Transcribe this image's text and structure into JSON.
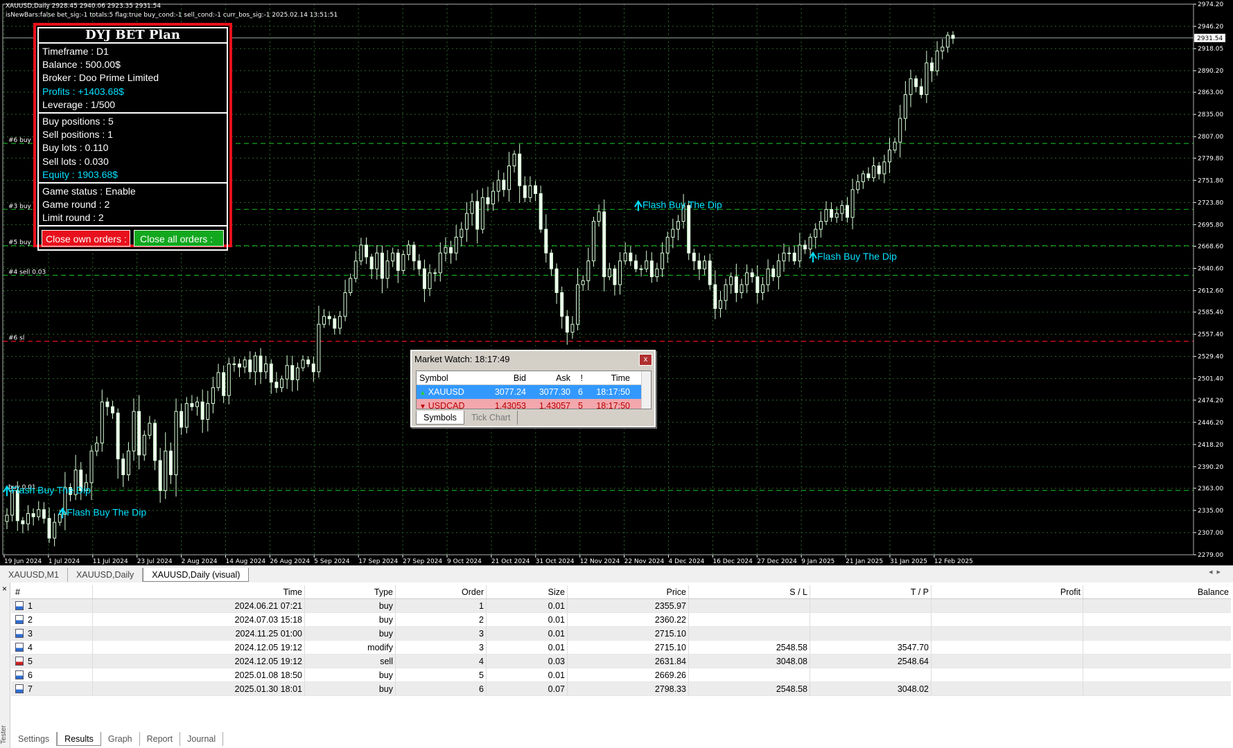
{
  "chart": {
    "symbol_info": "XAUUSD,Daily  2928.45 2940.06 2923.35 2931.54",
    "status_line": "isNewBars:false bet_sig:-1 totals:5 flag:true buy_cond:-1 sell_cond:-1 curr_bos_sig:-1 2025.02.14 13:51:51",
    "current_price": "2931.54",
    "price_labels": [
      "2974.20",
      "2946.20",
      "2918.05",
      "2890.20",
      "2863.00",
      "2835.00",
      "2807.00",
      "2779.80",
      "2751.80",
      "2723.80",
      "2695.80",
      "2668.60",
      "2640.60",
      "2612.60",
      "2585.40",
      "2557.40",
      "2529.40",
      "2501.40",
      "2474.20",
      "2446.20",
      "2418.20",
      "2390.20",
      "2363.00",
      "2335.00",
      "2307.00",
      "2279.00"
    ],
    "date_labels": [
      "19 Jun 2024",
      "1 Jul 2024",
      "11 Jul 2024",
      "23 Jul 2024",
      "2 Aug 2024",
      "14 Aug 2024",
      "26 Aug 2024",
      "5 Sep 2024",
      "17 Sep 2024",
      "27 Sep 2024",
      "9 Oct 2024",
      "21 Oct 2024",
      "31 Oct 2024",
      "12 Nov 2024",
      "22 Nov 2024",
      "4 Dec 2024",
      "16 Dec 2024",
      "27 Dec 2024",
      "9 Jan 2025",
      "21 Jan 2025",
      "31 Jan 2025",
      "12 Feb 2025"
    ],
    "level_lines": [
      {
        "label": "#6 buy",
        "price": 2798.33,
        "color": "#12a81e"
      },
      {
        "label": "#3 buy",
        "price": 2715.1,
        "color": "#12a81e"
      },
      {
        "label": "#5 buy",
        "price": 2669.26,
        "color": "#12a81e"
      },
      {
        "label": "#4 sell 0.03",
        "price": 2631.84,
        "color": "#12a81e"
      },
      {
        "label": "#6 sl",
        "price": 2548.58,
        "color": "#e8101c"
      },
      {
        "label": "buy 0.01",
        "price": 2360.22,
        "color": "#12a81e"
      }
    ],
    "annotations": [
      {
        "text": "Flash Buy The Dip",
        "date": "2024-06-19",
        "price": 2360
      },
      {
        "text": "Flash Buy The Dip",
        "date": "2024-07-03",
        "price": 2332
      },
      {
        "text": "Flash Buy The Dip",
        "date": "2024-11-25",
        "price": 2720
      },
      {
        "text": "Flash Buy The Dip",
        "date": "2025-01-08",
        "price": 2655
      }
    ]
  },
  "chart_data": {
    "type": "candlestick",
    "symbol": "XAUUSD",
    "timeframe": "Daily",
    "ylim": [
      2279,
      2974.2
    ],
    "x_range": [
      "19 Jun 2024",
      "14 Feb 2025"
    ],
    "close": [
      2329,
      2360,
      2322,
      2318,
      2331,
      2327,
      2336,
      2325,
      2300,
      2320,
      2330,
      2364,
      2355,
      2386,
      2360,
      2370,
      2410,
      2420,
      2472,
      2466,
      2458,
      2400,
      2380,
      2410,
      2460,
      2405,
      2430,
      2445,
      2398,
      2360,
      2410,
      2380,
      2460,
      2440,
      2470,
      2466,
      2472,
      2450,
      2470,
      2490,
      2509,
      2480,
      2520,
      2520,
      2516,
      2525,
      2510,
      2530,
      2510,
      2520,
      2497,
      2490,
      2501,
      2518,
      2500,
      2515,
      2525,
      2520,
      2510,
      2570,
      2580,
      2577,
      2565,
      2580,
      2610,
      2628,
      2650,
      2670,
      2655,
      2640,
      2660,
      2628,
      2650,
      2660,
      2638,
      2658,
      2670,
      2650,
      2640,
      2615,
      2635,
      2635,
      2660,
      2667,
      2660,
      2680,
      2690,
      2710,
      2725,
      2690,
      2730,
      2722,
      2738,
      2752,
      2740,
      2770,
      2785,
      2745,
      2730,
      2745,
      2735,
      2690,
      2660,
      2640,
      2610,
      2580,
      2560,
      2570,
      2620,
      2625,
      2650,
      2700,
      2712,
      2630,
      2640,
      2620,
      2650,
      2660,
      2650,
      2640,
      2640,
      2650,
      2630,
      2640,
      2660,
      2680,
      2690,
      2700,
      2720,
      2660,
      2650,
      2640,
      2650,
      2620,
      2590,
      2600,
      2620,
      2630,
      2610,
      2620,
      2635,
      2630,
      2610,
      2620,
      2640,
      2630,
      2650,
      2660,
      2660,
      2650,
      2670,
      2665,
      2680,
      2690,
      2700,
      2715,
      2705,
      2710,
      2720,
      2705,
      2740,
      2750,
      2760,
      2755,
      2770,
      2760,
      2775,
      2790,
      2800,
      2830,
      2860,
      2880,
      2870,
      2860,
      2900,
      2890,
      2915,
      2920,
      2935,
      2931
    ],
    "series": [
      {
        "name": "Flash Buy The Dip",
        "values": [
          "2024-06-19",
          "2024-07-03",
          "2024-11-25",
          "2025-01-08"
        ]
      }
    ]
  },
  "panel": {
    "title": "DYJ BET Plan",
    "timeframe": "Timeframe : D1",
    "balance": "Balance : 500.00$",
    "broker": "Broker : Doo Prime Limited",
    "profits": "Profits : +1403.68$",
    "leverage": "Leverage : 1/500",
    "buy_positions": "Buy positions : 5",
    "sell_positions": "Sell positions : 1",
    "buy_lots": "Buy lots : 0.110",
    "sell_lots": "Sell lots : 0.030",
    "equity": "Equity : 1903.68$",
    "game_status": "Game status :  Enable",
    "game_round": "Game round : 2",
    "limit_round": "Limit round : 2",
    "close_own": "Close own orders :",
    "close_all": "Close all orders :",
    "colors": {
      "border": "#e8101c",
      "cyan": "#00e0ff",
      "green_button": "#12a81e"
    }
  },
  "market_watch": {
    "title": "Market Watch: 18:17:49",
    "close": "x",
    "headers": [
      "Symbol",
      "Bid",
      "Ask",
      "!",
      "Time"
    ],
    "rows": [
      {
        "symbol": "XAUUSD",
        "bid": "3077.24",
        "ask": "3077.30",
        "spread": "6",
        "time": "18:17:50"
      },
      {
        "symbol": "USDCAD",
        "bid": "1.43053",
        "ask": "1.43057",
        "spread": "5",
        "time": "18:17:50"
      }
    ],
    "tabs": [
      "Symbols",
      "Tick Chart"
    ]
  },
  "chart_tabs": [
    "XAUUSD,M1",
    "XAUUSD,Daily",
    "XAUUSD,Daily (visual)"
  ],
  "results": {
    "headers": [
      "#",
      "Time",
      "Type",
      "Order",
      "Size",
      "Price",
      "S / L",
      "T / P",
      "Profit",
      "Balance"
    ],
    "rows": [
      {
        "n": "1",
        "time": "2024.06.21 07:21",
        "type": "buy",
        "order": "1",
        "size": "0.01",
        "price": "2355.97",
        "sl": "",
        "tp": "",
        "profit": "",
        "balance": ""
      },
      {
        "n": "2",
        "time": "2024.07.03 15:18",
        "type": "buy",
        "order": "2",
        "size": "0.01",
        "price": "2360.22",
        "sl": "",
        "tp": "",
        "profit": "",
        "balance": ""
      },
      {
        "n": "3",
        "time": "2024.11.25 01:00",
        "type": "buy",
        "order": "3",
        "size": "0.01",
        "price": "2715.10",
        "sl": "",
        "tp": "",
        "profit": "",
        "balance": ""
      },
      {
        "n": "4",
        "time": "2024.12.05 19:12",
        "type": "modify",
        "order": "3",
        "size": "0.01",
        "price": "2715.10",
        "sl": "2548.58",
        "tp": "3547.70",
        "profit": "",
        "balance": ""
      },
      {
        "n": "5",
        "time": "2024.12.05 19:12",
        "type": "sell",
        "order": "4",
        "size": "0.03",
        "price": "2631.84",
        "sl": "3048.08",
        "tp": "2548.64",
        "profit": "",
        "balance": ""
      },
      {
        "n": "6",
        "time": "2025.01.08 18:50",
        "type": "buy",
        "order": "5",
        "size": "0.01",
        "price": "2669.26",
        "sl": "",
        "tp": "",
        "profit": "",
        "balance": ""
      },
      {
        "n": "7",
        "time": "2025.01.30 18:01",
        "type": "buy",
        "order": "6",
        "size": "0.07",
        "price": "2798.33",
        "sl": "2548.58",
        "tp": "3048.02",
        "profit": "",
        "balance": ""
      }
    ]
  },
  "tester": {
    "close": "×",
    "label": "Tester",
    "tabs": [
      "Settings",
      "Results",
      "Graph",
      "Report",
      "Journal"
    ],
    "active_tab": "Results"
  }
}
